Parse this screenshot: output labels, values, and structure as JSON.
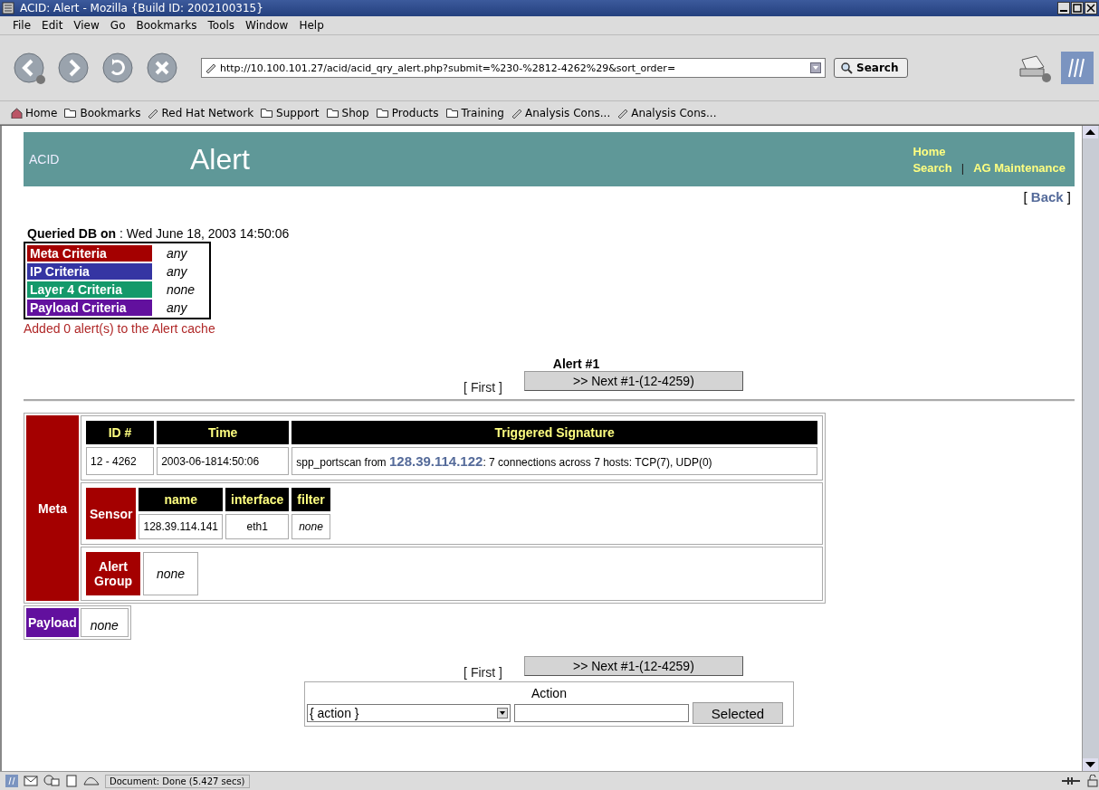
{
  "window": {
    "title": "ACID: Alert - Mozilla {Build ID: 2002100315}"
  },
  "menu": [
    "File",
    "Edit",
    "View",
    "Go",
    "Bookmarks",
    "Tools",
    "Window",
    "Help"
  ],
  "toolbar": {
    "url": "http://10.100.101.27/acid/acid_qry_alert.php?submit=%230-%2812-4262%29&sort_order=",
    "search_button": "Search"
  },
  "personal_bar": [
    {
      "kind": "home",
      "label": "Home"
    },
    {
      "kind": "folder",
      "label": "Bookmarks"
    },
    {
      "kind": "link",
      "label": "Red Hat Network"
    },
    {
      "kind": "folder",
      "label": "Support"
    },
    {
      "kind": "folder",
      "label": "Shop"
    },
    {
      "kind": "folder",
      "label": "Products"
    },
    {
      "kind": "folder",
      "label": "Training"
    },
    {
      "kind": "link",
      "label": "Analysis Cons..."
    },
    {
      "kind": "link",
      "label": "Analysis Cons..."
    }
  ],
  "page": {
    "header": {
      "logo": "ACID",
      "title": "Alert",
      "links": [
        "Home",
        "Search",
        "AG Maintenance"
      ],
      "separator": "|"
    },
    "back": {
      "open": "[",
      "label": "Back",
      "close": "]"
    },
    "queried": "**Queried DB on** : Wed June 18, 2003 14:50:06",
    "criteria": [
      {
        "label": "Meta Criteria",
        "value": "any",
        "color": "#a40000"
      },
      {
        "label": "IP Criteria",
        "value": "any",
        "color": "#3535a3"
      },
      {
        "label": "Layer 4 Criteria",
        "value": "none",
        "color": "#14996a"
      },
      {
        "label": "Payload Criteria",
        "value": "any",
        "color": "#62109e"
      }
    ],
    "cache_message": "Added 0 alert(s) to the Alert cache",
    "alert_heading": "Alert #1",
    "top_nav": {
      "first": "[ First ]",
      "next": ">> Next #1-(12-4259)"
    },
    "meta": {
      "label": "Meta",
      "columns": [
        "ID #",
        "Time",
        "Triggered Signature"
      ],
      "row": [
        "12 - 4262",
        "2003-06-1814:50:06",
        "spp_portscan from **128.39.114.122**: 7 connections across 7 hosts: TCP(7), UDP(0)"
      ],
      "sensor": {
        "label": "Sensor",
        "columns": [
          "name",
          "interface",
          "filter"
        ],
        "row": [
          {
            "text": "128.39.114.141",
            "italic": false
          },
          {
            "text": "eth1",
            "italic": false
          },
          {
            "text": "none",
            "italic": true
          }
        ]
      },
      "alert_group": {
        "label": "Alert Group",
        "value": "none"
      }
    },
    "payload": {
      "label": "Payload",
      "value": "none"
    },
    "bottom_nav": {
      "first": "[ First ]",
      "next": ">> Next #1-(12-4259)"
    },
    "action": {
      "title": "Action",
      "select": "{ action }",
      "button": "Selected"
    }
  },
  "status_bar": {
    "text": "Document: Done (5.427 secs)"
  }
}
